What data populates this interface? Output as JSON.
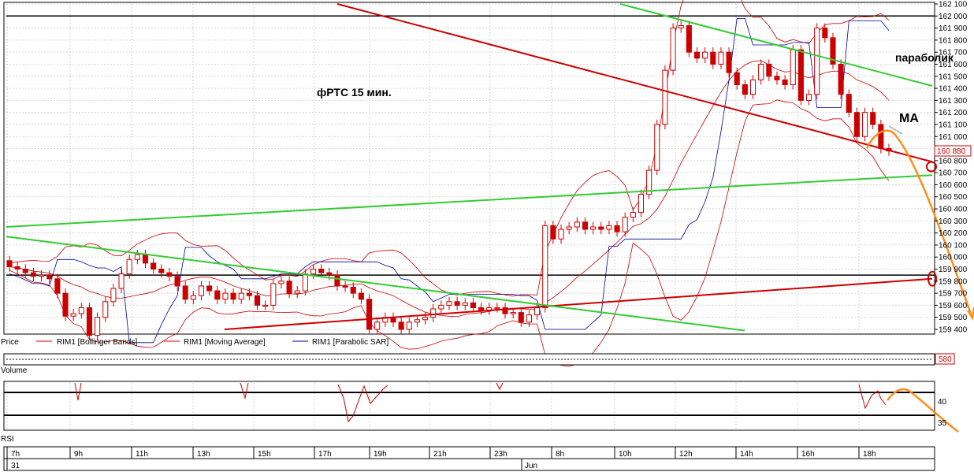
{
  "chart_data": {
    "type": "candlestick",
    "title": "фРТС   15 мин.",
    "price_axis": {
      "ylim": [
        159400,
        162100
      ],
      "ticks": [
        159400,
        159500,
        159600,
        159700,
        159800,
        159900,
        160000,
        160100,
        160200,
        160300,
        160400,
        160500,
        160600,
        160700,
        160800,
        160900,
        161000,
        161100,
        161200,
        161300,
        161400,
        161500,
        161600,
        161700,
        161800,
        161900,
        162000,
        162100
      ],
      "tick_labels": [
        "159 400",
        "159 500",
        "159 600",
        "159 700",
        "159 800",
        "159 900",
        "160 000",
        "160 100",
        "160 200",
        "160 300",
        "160 400",
        "160 500",
        "160 600",
        "160 700",
        "160 800",
        "160 900",
        "161 000",
        "161 100",
        "161 200",
        "161 300",
        "161 400",
        "161 500",
        "161 600",
        "161 700",
        "161 800",
        "161 900",
        "162 000",
        "162 100"
      ],
      "last_price": 160880,
      "last_price_label": "160 880",
      "grid": true
    },
    "time_axis": {
      "hour_labels": [
        "7h",
        "9h",
        "11h",
        "13h",
        "15h",
        "17h",
        "19h",
        "21h",
        "23h",
        "8h",
        "10h",
        "12h",
        "14h",
        "16h",
        "18h"
      ],
      "date_labels": [
        "31",
        "Jun"
      ]
    },
    "legend": [
      "Price",
      "RIM1 [Bollinger Bands]",
      "RIM1 [Moving Average]",
      "RIM1 [Parabolic SAR]"
    ],
    "annotations": [
      "параболик",
      "MA"
    ],
    "horizontal_levels": [
      162000,
      159850
    ],
    "trend_lines": [
      {
        "color": "#cc0000",
        "from": [
          0,
          162100
        ],
        "to": [
          1,
          160790
        ]
      },
      {
        "color": "#cc0000",
        "from": [
          0,
          159400
        ],
        "to": [
          1,
          159820
        ]
      },
      {
        "color": "#33cc33",
        "from": [
          0,
          160250
        ],
        "to": [
          1,
          160680
        ]
      },
      {
        "color": "#33cc33",
        "from": [
          0,
          160170
        ],
        "to": [
          1,
          159390
        ]
      },
      {
        "color": "#33cc33",
        "from": [
          0,
          162100
        ],
        "to": [
          1,
          161420
        ]
      }
    ],
    "candles": [
      [
        159970,
        159920
      ],
      [
        159920,
        159900
      ],
      [
        159900,
        159870
      ],
      [
        159870,
        159840
      ],
      [
        159840,
        159850
      ],
      [
        159850,
        159820
      ],
      [
        159820,
        159700
      ],
      [
        159700,
        159510
      ],
      [
        159510,
        159530
      ],
      [
        159530,
        159580
      ],
      [
        159580,
        159350
      ],
      [
        159350,
        159500
      ],
      [
        159500,
        159630
      ],
      [
        159630,
        159740
      ],
      [
        159740,
        159860
      ],
      [
        159860,
        159980
      ],
      [
        159980,
        160020
      ],
      [
        160020,
        159950
      ],
      [
        159950,
        159900
      ],
      [
        159900,
        159870
      ],
      [
        159870,
        159840
      ],
      [
        159840,
        159760
      ],
      [
        159760,
        159650
      ],
      [
        159650,
        159680
      ],
      [
        159680,
        159760
      ],
      [
        159760,
        159720
      ],
      [
        159720,
        159650
      ],
      [
        159650,
        159700
      ],
      [
        159700,
        159650
      ],
      [
        159650,
        159700
      ],
      [
        159700,
        159680
      ],
      [
        159680,
        159600
      ],
      [
        159600,
        159600
      ],
      [
        159600,
        159780
      ],
      [
        159780,
        159800
      ],
      [
        159800,
        159700
      ],
      [
        159700,
        159720
      ],
      [
        159720,
        159860
      ],
      [
        159860,
        159900
      ],
      [
        159900,
        159870
      ],
      [
        159870,
        159850
      ],
      [
        159850,
        159760
      ],
      [
        159760,
        159750
      ],
      [
        159750,
        159700
      ],
      [
        159700,
        159650
      ],
      [
        159650,
        159400
      ],
      [
        159400,
        159460
      ],
      [
        159460,
        159500
      ],
      [
        159500,
        159460
      ],
      [
        159460,
        159400
      ],
      [
        159400,
        159460
      ],
      [
        159460,
        159480
      ],
      [
        159480,
        159500
      ],
      [
        159500,
        159570
      ],
      [
        159570,
        159600
      ],
      [
        159600,
        159630
      ],
      [
        159630,
        159600
      ],
      [
        159600,
        159620
      ],
      [
        159620,
        159580
      ],
      [
        159580,
        159560
      ],
      [
        159560,
        159580
      ],
      [
        159580,
        159580
      ],
      [
        159580,
        159530
      ],
      [
        159530,
        159540
      ],
      [
        159540,
        159460
      ],
      [
        159460,
        159520
      ],
      [
        159520,
        159580
      ],
      [
        159580,
        160260
      ],
      [
        160260,
        160150
      ],
      [
        160150,
        160230
      ],
      [
        160230,
        160250
      ],
      [
        160250,
        160290
      ],
      [
        160290,
        160230
      ],
      [
        160230,
        160250
      ],
      [
        160250,
        160230
      ],
      [
        160230,
        160260
      ],
      [
        160260,
        160210
      ],
      [
        160210,
        160330
      ],
      [
        160330,
        160370
      ],
      [
        160370,
        160520
      ],
      [
        160520,
        160720
      ],
      [
        160720,
        161100
      ],
      [
        161100,
        161550
      ],
      [
        161550,
        161900
      ],
      [
        161900,
        161920
      ],
      [
        161920,
        161700
      ],
      [
        161700,
        161650
      ],
      [
        161650,
        161700
      ],
      [
        161700,
        161600
      ],
      [
        161600,
        161700
      ],
      [
        161700,
        161530
      ],
      [
        161530,
        161430
      ],
      [
        161430,
        161350
      ],
      [
        161350,
        161470
      ],
      [
        161470,
        161600
      ],
      [
        161600,
        161500
      ],
      [
        161500,
        161470
      ],
      [
        161470,
        161430
      ],
      [
        161430,
        161720
      ],
      [
        161720,
        161300
      ],
      [
        161300,
        161350
      ],
      [
        161350,
        161900
      ],
      [
        161900,
        161820
      ],
      [
        161820,
        161600
      ],
      [
        161600,
        161350
      ],
      [
        161350,
        161200
      ],
      [
        161200,
        161000
      ],
      [
        161000,
        161200
      ],
      [
        161200,
        161100
      ],
      [
        161100,
        160900
      ],
      [
        160900,
        160880
      ]
    ]
  },
  "volume_panel": {
    "label": "Volume",
    "value_label": "580"
  },
  "rsi_panel": {
    "label": "RSI",
    "ticks": [
      "40",
      "35"
    ]
  }
}
